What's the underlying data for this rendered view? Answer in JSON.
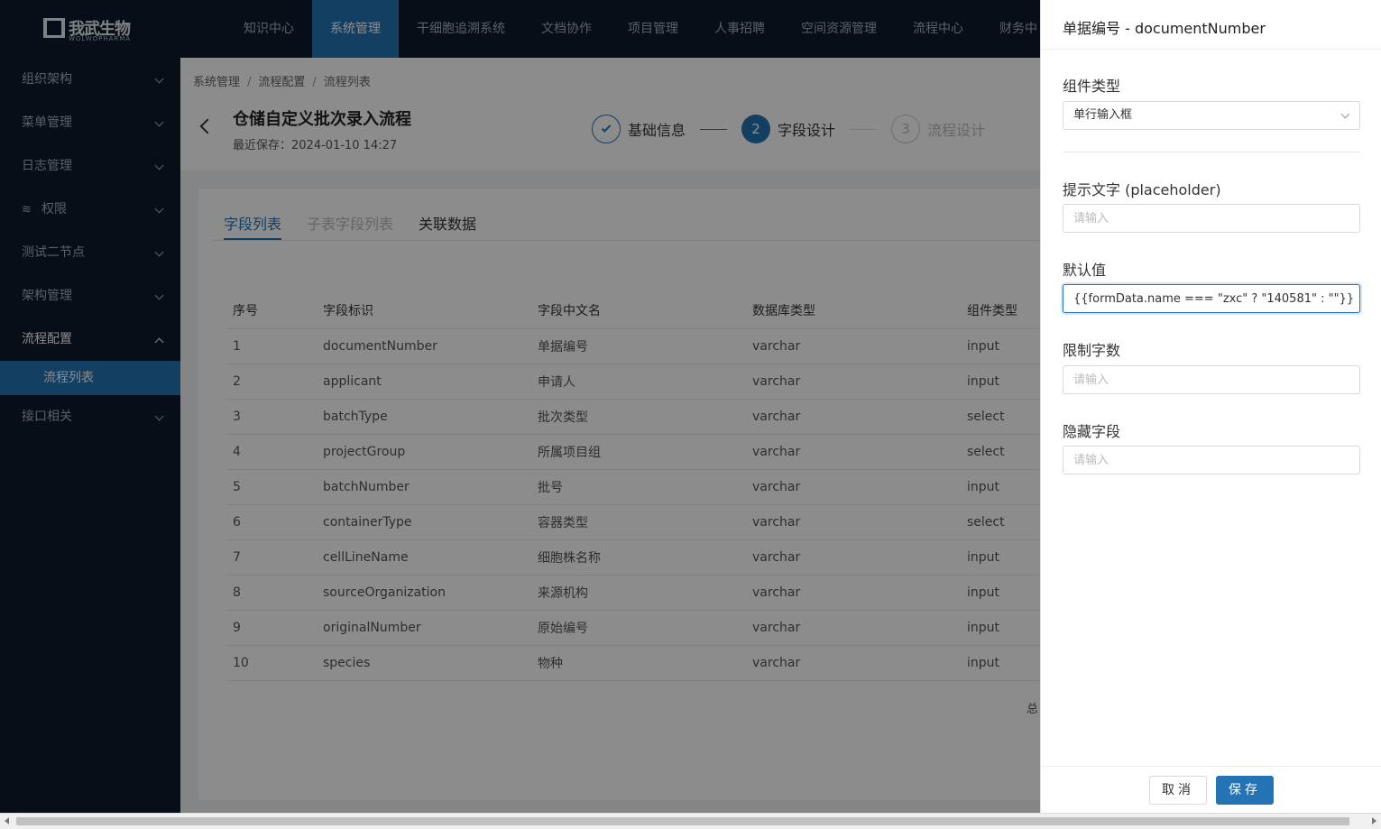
{
  "brand": {
    "name_cn": "我武生物",
    "name_en": "WOLWOPHARMA"
  },
  "topnav": [
    {
      "label": "知识中心"
    },
    {
      "label": "系统管理"
    },
    {
      "label": "干细胞追溯系统"
    },
    {
      "label": "文档协作"
    },
    {
      "label": "项目管理"
    },
    {
      "label": "人事招聘"
    },
    {
      "label": "空间资源管理"
    },
    {
      "label": "流程中心"
    },
    {
      "label": "财务中"
    }
  ],
  "topnav_active_index": 1,
  "sidebar": {
    "items": [
      {
        "label": "组织架构"
      },
      {
        "label": "菜单管理"
      },
      {
        "label": "日志管理"
      },
      {
        "label": "权限",
        "icon": "layers-icon"
      },
      {
        "label": "测试二节点"
      },
      {
        "label": "架构管理"
      },
      {
        "label": "流程配置"
      },
      {
        "label": "接口相关"
      }
    ],
    "sub_item": {
      "label": "流程列表"
    }
  },
  "breadcrumb": [
    "系统管理",
    "流程配置",
    "流程列表"
  ],
  "header": {
    "title": "仓储自定义批次录入流程",
    "saved": "最近保存：2024-01-10 14:27"
  },
  "steps": [
    {
      "number": "1",
      "label": "基础信息",
      "state": "done"
    },
    {
      "number": "2",
      "label": "字段设计",
      "state": "current"
    },
    {
      "number": "3",
      "label": "流程设计",
      "state": "todo"
    }
  ],
  "tabs": [
    {
      "label": "字段列表",
      "state": "active"
    },
    {
      "label": "子表字段列表",
      "state": "disabled"
    },
    {
      "label": "关联数据",
      "state": "normal"
    }
  ],
  "table": {
    "columns": [
      "序号",
      "字段标识",
      "字段中文名",
      "数据库类型",
      "组件类型"
    ],
    "rows": [
      [
        "1",
        "documentNumber",
        "单据编号",
        "varchar",
        "input"
      ],
      [
        "2",
        "applicant",
        "申请人",
        "varchar",
        "input"
      ],
      [
        "3",
        "batchType",
        "批次类型",
        "varchar",
        "select"
      ],
      [
        "4",
        "projectGroup",
        "所属项目组",
        "varchar",
        "select"
      ],
      [
        "5",
        "batchNumber",
        "批号",
        "varchar",
        "input"
      ],
      [
        "6",
        "containerType",
        "容器类型",
        "varchar",
        "select"
      ],
      [
        "7",
        "cellLineName",
        "细胞株名称",
        "varchar",
        "input"
      ],
      [
        "8",
        "sourceOrganization",
        "来源机构",
        "varchar",
        "input"
      ],
      [
        "9",
        "originalNumber",
        "原始编号",
        "varchar",
        "input"
      ],
      [
        "10",
        "species",
        "物种",
        "varchar",
        "input"
      ]
    ],
    "total_fragment": "总"
  },
  "drawer": {
    "title": "单据编号 - documentNumber",
    "component_type_label": "组件类型",
    "component_type_value": "单行输入框",
    "placeholder_label": "提示文字 (placeholder)",
    "placeholder_placeholder": "请输入",
    "default_label": "默认值",
    "default_value": "{{formData.name === \"zxc\" ? \"140581\" : \"\"}}",
    "maxlength_label": "限制字数",
    "maxlength_placeholder": "请输入",
    "hidden_label": "隐藏字段",
    "hidden_placeholder": "请输入",
    "cancel_label": "取消",
    "save_label": "保存"
  },
  "colors": {
    "primary": "#2474b5",
    "nav_bg": "#0e1a2c"
  }
}
